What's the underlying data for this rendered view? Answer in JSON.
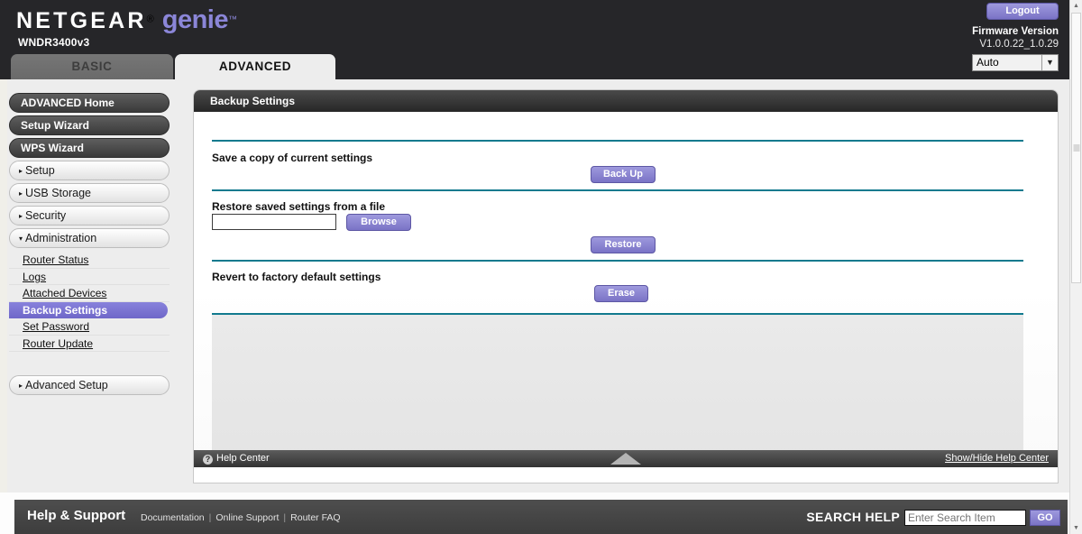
{
  "header": {
    "brand_netgear": "NETGEAR",
    "brand_reg": "®",
    "brand_genie": "genie",
    "brand_tm": "™",
    "model": "WNDR3400v3",
    "logout_label": "Logout",
    "firmware_label": "Firmware Version",
    "firmware_value": "V1.0.0.22_1.0.29",
    "language_selected": "Auto",
    "language_caret": "▼"
  },
  "tabs": [
    {
      "label": "BASIC",
      "active": false
    },
    {
      "label": "ADVANCED",
      "active": true
    }
  ],
  "sidebar": {
    "primary": [
      {
        "label": "ADVANCED Home"
      },
      {
        "label": "Setup Wizard"
      },
      {
        "label": "WPS Wizard"
      }
    ],
    "sections": [
      {
        "label": "Setup",
        "caret": "▸",
        "expanded": false
      },
      {
        "label": "USB Storage",
        "caret": "▸",
        "expanded": false
      },
      {
        "label": "Security",
        "caret": "▸",
        "expanded": false
      },
      {
        "label": "Administration",
        "caret": "▾",
        "expanded": true
      }
    ],
    "administration_items": [
      {
        "label": "Router Status",
        "active": false
      },
      {
        "label": "Logs",
        "active": false
      },
      {
        "label": "Attached Devices",
        "active": false
      },
      {
        "label": "Backup Settings",
        "active": true
      },
      {
        "label": "Set Password",
        "active": false
      },
      {
        "label": "Router Update",
        "active": false
      }
    ],
    "advanced_setup": {
      "label": "Advanced Setup",
      "caret": "▸"
    }
  },
  "panel": {
    "title": "Backup Settings",
    "backup": {
      "label": "Save a copy of current settings",
      "button": "Back Up"
    },
    "restore": {
      "label": "Restore saved settings from a file",
      "file_value": "",
      "browse_button": "Browse",
      "restore_button": "Restore"
    },
    "revert": {
      "label": "Revert to factory default settings",
      "button": "Erase"
    },
    "footer": {
      "help_center": "Help Center",
      "help_icon_glyph": "?",
      "show_hide": "Show/Hide Help Center"
    }
  },
  "footer": {
    "title": "Help & Support",
    "links": [
      "Documentation",
      "Online Support",
      "Router FAQ"
    ],
    "separator": "|",
    "search_label": "SEARCH HELP",
    "search_placeholder": "Enter Search Item",
    "go_label": "GO"
  },
  "scrollbar": {
    "up_glyph": "▲",
    "down_glyph": "▼"
  },
  "colors": {
    "accent_purple": "#7a73c6",
    "divider_teal": "#127a8e",
    "banner_dark": "#262629",
    "genie_purple": "#8b86d8"
  }
}
